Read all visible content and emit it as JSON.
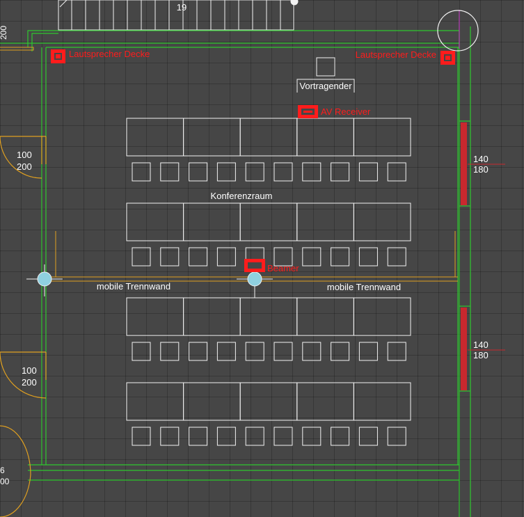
{
  "colors": {
    "wall": "#2fc82f",
    "door": "#e0a020",
    "furniture": "#f2f2f2",
    "device": "#ff1c1c",
    "window": "#c8282e",
    "text": "#ffffff",
    "column_fill": "#8fd0e0"
  },
  "labels": {
    "room_name": "Konferenzraum",
    "presenter": "Vortragender",
    "speaker_left": "Lautsprecher Decke",
    "speaker_right": "Lautsprecher Decke",
    "av_receiver": "AV Receiver",
    "beamer": "Beamer",
    "partition_left": "mobile Trennwand",
    "partition_right": "mobile Trennwand",
    "stair_step_number": "19",
    "top_left_dim": "200",
    "door_upper_w": "100",
    "door_upper_h": "200",
    "door_lower_w": "100",
    "door_lower_h": "200",
    "window_upper_w": "140",
    "window_upper_h": "180",
    "window_lower_w": "140",
    "window_lower_h": "180",
    "bottom_left_dim_1": "6",
    "bottom_left_dim_2": "00"
  },
  "layout_data": {
    "table_rows": 4,
    "tables_per_row": 5,
    "chairs_per_row": 10
  }
}
